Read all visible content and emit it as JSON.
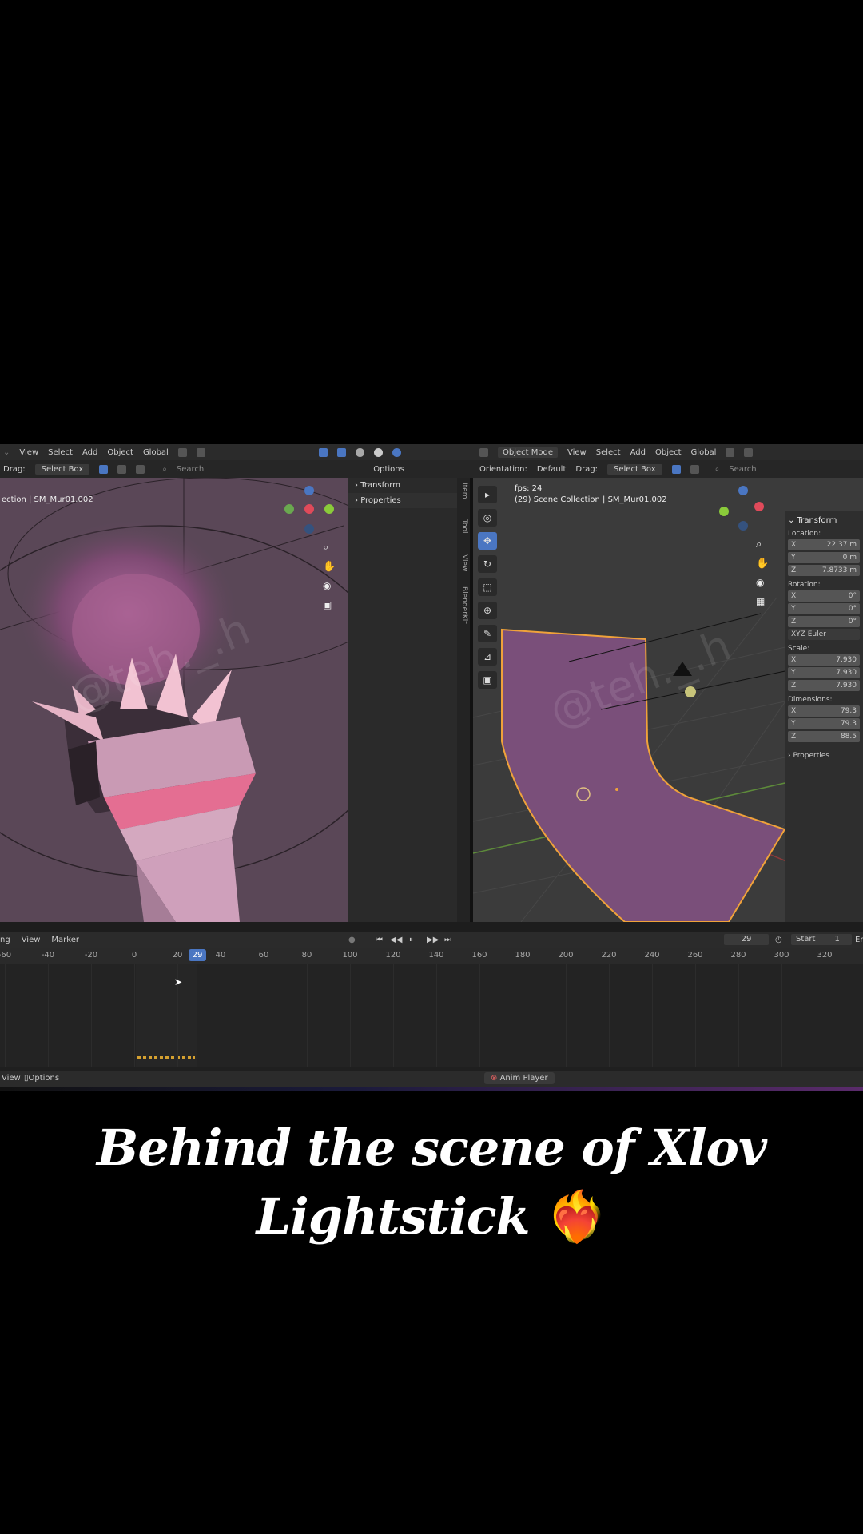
{
  "left_view": {
    "header": [
      "View",
      "Select",
      "Add",
      "Object",
      "Global"
    ],
    "drag_label": "Drag:",
    "drag_value": "Select Box",
    "search_placeholder": "Search",
    "options_label": "Options",
    "overlay_text": "ection | SM_Mur01.002",
    "panel_items": [
      "Transform",
      "Properties"
    ],
    "side_tabs": [
      "Item",
      "Tool",
      "View",
      "BlenderKit"
    ]
  },
  "right_view": {
    "mode": "Object Mode",
    "header": [
      "View",
      "Select",
      "Add",
      "Object",
      "Global"
    ],
    "orientation_label": "Orientation:",
    "orientation_value": "Default",
    "drag_label": "Drag:",
    "drag_value": "Select Box",
    "search_placeholder": "Search",
    "fps_text": "fps: 24",
    "collection_text": "(29) Scene Collection | SM_Mur01.002",
    "transform": {
      "title": "Transform",
      "location_label": "Location:",
      "location": [
        {
          "axis": "X",
          "value": "22.37 m"
        },
        {
          "axis": "Y",
          "value": "0 m"
        },
        {
          "axis": "Z",
          "value": "7.8733 m"
        }
      ],
      "rotation_label": "Rotation:",
      "rotation": [
        {
          "axis": "X",
          "value": "0°"
        },
        {
          "axis": "Y",
          "value": "0°"
        },
        {
          "axis": "Z",
          "value": "0°"
        }
      ],
      "rotation_mode": "XYZ Euler",
      "scale_label": "Scale:",
      "scale": [
        {
          "axis": "X",
          "value": "7.930"
        },
        {
          "axis": "Y",
          "value": "7.930"
        },
        {
          "axis": "Z",
          "value": "7.930"
        }
      ],
      "dimensions_label": "Dimensions:",
      "dimensions": [
        {
          "axis": "X",
          "value": "79.3"
        },
        {
          "axis": "Y",
          "value": "79.3"
        },
        {
          "axis": "Z",
          "value": "88.5"
        }
      ],
      "properties": "Properties"
    }
  },
  "timeline": {
    "menu": [
      "ng",
      "View",
      "Marker"
    ],
    "current_frame": "29",
    "frame_field": "29",
    "start_label": "Start",
    "start_value": "1",
    "end_label": "En",
    "ticks": [
      "-60",
      "-40",
      "-20",
      "0",
      "20",
      "40",
      "60",
      "80",
      "100",
      "120",
      "140",
      "160",
      "180",
      "200",
      "220",
      "240",
      "260",
      "280",
      "300",
      "320"
    ]
  },
  "statusbar": {
    "view": "View",
    "options": "Options",
    "anim_player": "Anim Player"
  },
  "watermark": "@teh._.h",
  "caption": {
    "line1": "Behind the scene of Xlov",
    "line2": "Lightstick",
    "emoji": "❤️‍🔥"
  },
  "colors": {
    "lightstick": "#d9a8c0",
    "viewport_left": "#5a4757",
    "wall_selected": "#7a4f7a",
    "selection_outline": "#f0a23a",
    "active_tool": "#4a76c2"
  }
}
